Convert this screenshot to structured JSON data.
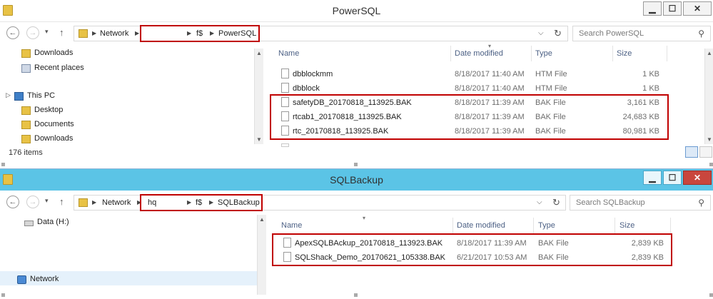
{
  "window1": {
    "title": "PowerSQL",
    "controls": {
      "minimize": "▁",
      "maximize": "☐",
      "close": "✕"
    },
    "address": {
      "crumbs": [
        "Network",
        "f$",
        "PowerSQL"
      ],
      "refresh": "↻",
      "dropdown": "⌵"
    },
    "search_placeholder": "Search PowerSQL",
    "nav": [
      {
        "label": "Downloads",
        "icon": "downloads-icon"
      },
      {
        "label": "Recent places",
        "icon": "recent-places-icon"
      },
      {
        "label": "This PC",
        "icon": "this-pc-icon"
      },
      {
        "label": "Desktop",
        "icon": "desktop-folder-icon"
      },
      {
        "label": "Documents",
        "icon": "documents-folder-icon"
      },
      {
        "label": "Downloads",
        "icon": "downloads-icon"
      }
    ],
    "columns": [
      "Name",
      "Date modified",
      "Type",
      "Size"
    ],
    "rows": [
      {
        "name": "dbblockmm",
        "date": "8/18/2017 11:40 AM",
        "type": "HTM File",
        "size": "1 KB"
      },
      {
        "name": "dbblock",
        "date": "8/18/2017 11:40 AM",
        "type": "HTM File",
        "size": "1 KB"
      },
      {
        "name": "safetyDB_20170818_113925.BAK",
        "date": "8/18/2017 11:39 AM",
        "type": "BAK File",
        "size": "3,161 KB"
      },
      {
        "name": "rtcab1_20170818_113925.BAK",
        "date": "8/18/2017 11:39 AM",
        "type": "BAK File",
        "size": "24,683 KB"
      },
      {
        "name": "rtc_20170818_113925.BAK",
        "date": "8/18/2017 11:39 AM",
        "type": "BAK File",
        "size": "80,981 KB"
      }
    ],
    "status": "176 items"
  },
  "window2": {
    "title": "SQLBackup",
    "controls": {
      "minimize": "▁",
      "maximize": "☐",
      "close": "✕"
    },
    "address": {
      "crumbs": [
        "Network",
        "hq",
        "f$",
        "SQLBackup"
      ],
      "refresh": "↻",
      "dropdown": "⌵"
    },
    "search_placeholder": "Search SQLBackup",
    "nav": [
      {
        "label": "Data (H:)",
        "icon": "drive-icon"
      },
      {
        "label": "Network",
        "icon": "network-icon"
      }
    ],
    "columns": [
      "Name",
      "Date modified",
      "Type",
      "Size"
    ],
    "rows": [
      {
        "name": "ApexSQLBAckup_20170818_113923.BAK",
        "date": "8/18/2017 11:39 AM",
        "type": "BAK File",
        "size": "2,839 KB"
      },
      {
        "name": "SQLShack_Demo_20170621_105338.BAK",
        "date": "6/21/2017 10:53 AM",
        "type": "BAK File",
        "size": "2,839 KB"
      }
    ]
  },
  "glyphs": {
    "back": "←",
    "forward": "→",
    "up": "↑",
    "chevron": "▾",
    "sep": "▶",
    "search": "⚲",
    "expand": "▷",
    "scroll_up": "▲",
    "scroll_down": "▼"
  },
  "colors": {
    "highlight": "#c00000",
    "active_title": "#5bc4e6",
    "close_button": "#c9463d"
  }
}
